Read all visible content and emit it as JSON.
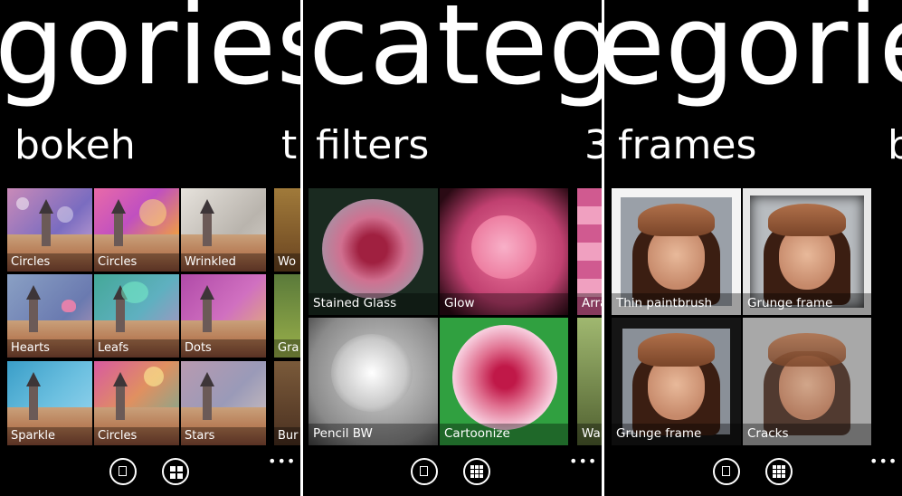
{
  "panels": [
    {
      "title": "gories",
      "subtitle": "bokeh",
      "next_peek": "t",
      "tiles": [
        "Circles",
        "Circles",
        "Wrinkled",
        "Hearts",
        "Leafs",
        "Dots",
        "Sparkle",
        "Circles",
        "Stars"
      ],
      "peek_tiles": [
        "Wo",
        "Gra",
        "Bur"
      ]
    },
    {
      "title": "catego",
      "subtitle": "filters",
      "next_peek": "3",
      "tiles": [
        "Stained Glass",
        "Glow",
        "Pencil BW",
        "Cartoonize"
      ],
      "peek_tiles": [
        "Arra",
        "War"
      ]
    },
    {
      "title": "egorie",
      "subtitle": "frames",
      "next_peek": "b",
      "tiles": [
        "Thin paintbrush",
        "Grunge frame",
        "Grunge frame",
        "Cracks"
      ]
    }
  ],
  "app_bar": {
    "more_glyph": "•••",
    "icons": [
      "single-view-icon",
      "grid-view-icon"
    ]
  },
  "colors": {
    "background": "#000000",
    "foreground": "#ffffff",
    "divider": "#ffffff"
  }
}
